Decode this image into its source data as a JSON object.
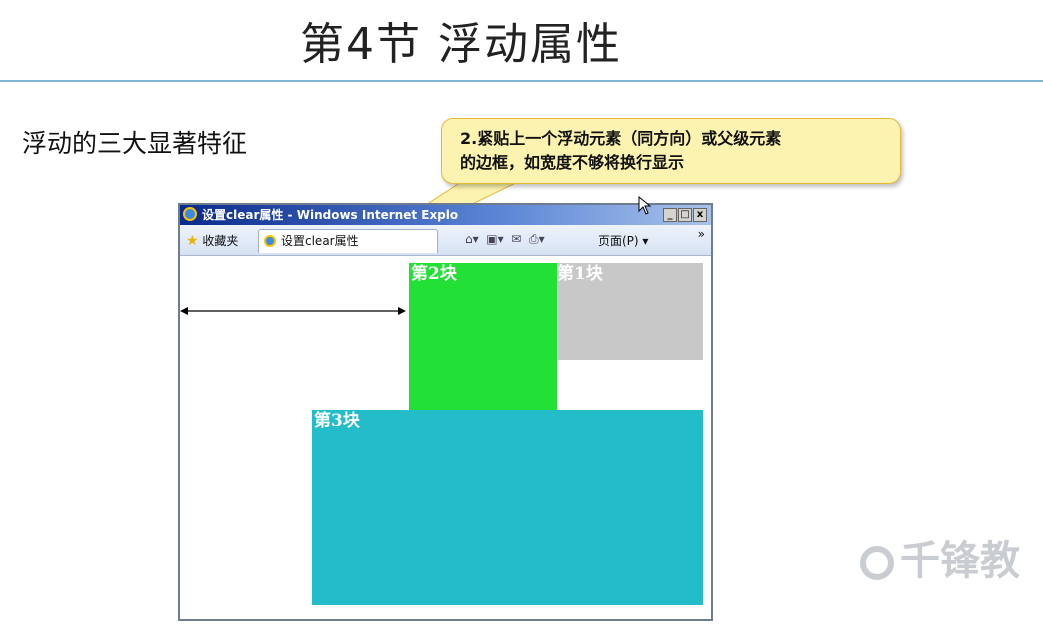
{
  "slide": {
    "title": "第4节 浮动属性",
    "subtitle": "浮动的三大显著特征",
    "callout_line1": "2.紧贴上一个浮动元素（同方向）或父级元素",
    "callout_line2": "的边框，如宽度不够将换行显示"
  },
  "browser": {
    "window_title": "设置clear属性 - Windows Internet Explo",
    "favorites_label": "收藏夹",
    "tab_label": "设置clear属性",
    "page_menu": "页面(P) ▾",
    "chevron": "»",
    "minimize": "_",
    "maximize": "□",
    "close": "x"
  },
  "blocks": {
    "block1_label": "第1块",
    "block2_label": "第2块",
    "block3_label": "第3块"
  },
  "watermark": {
    "text": "千锋教"
  },
  "colors": {
    "block1": "#c8c8c8",
    "block2": "#22e035",
    "block3": "#23bcc9",
    "callout_bg": "#fdf3b0",
    "title_rule": "#7fb3d5"
  }
}
